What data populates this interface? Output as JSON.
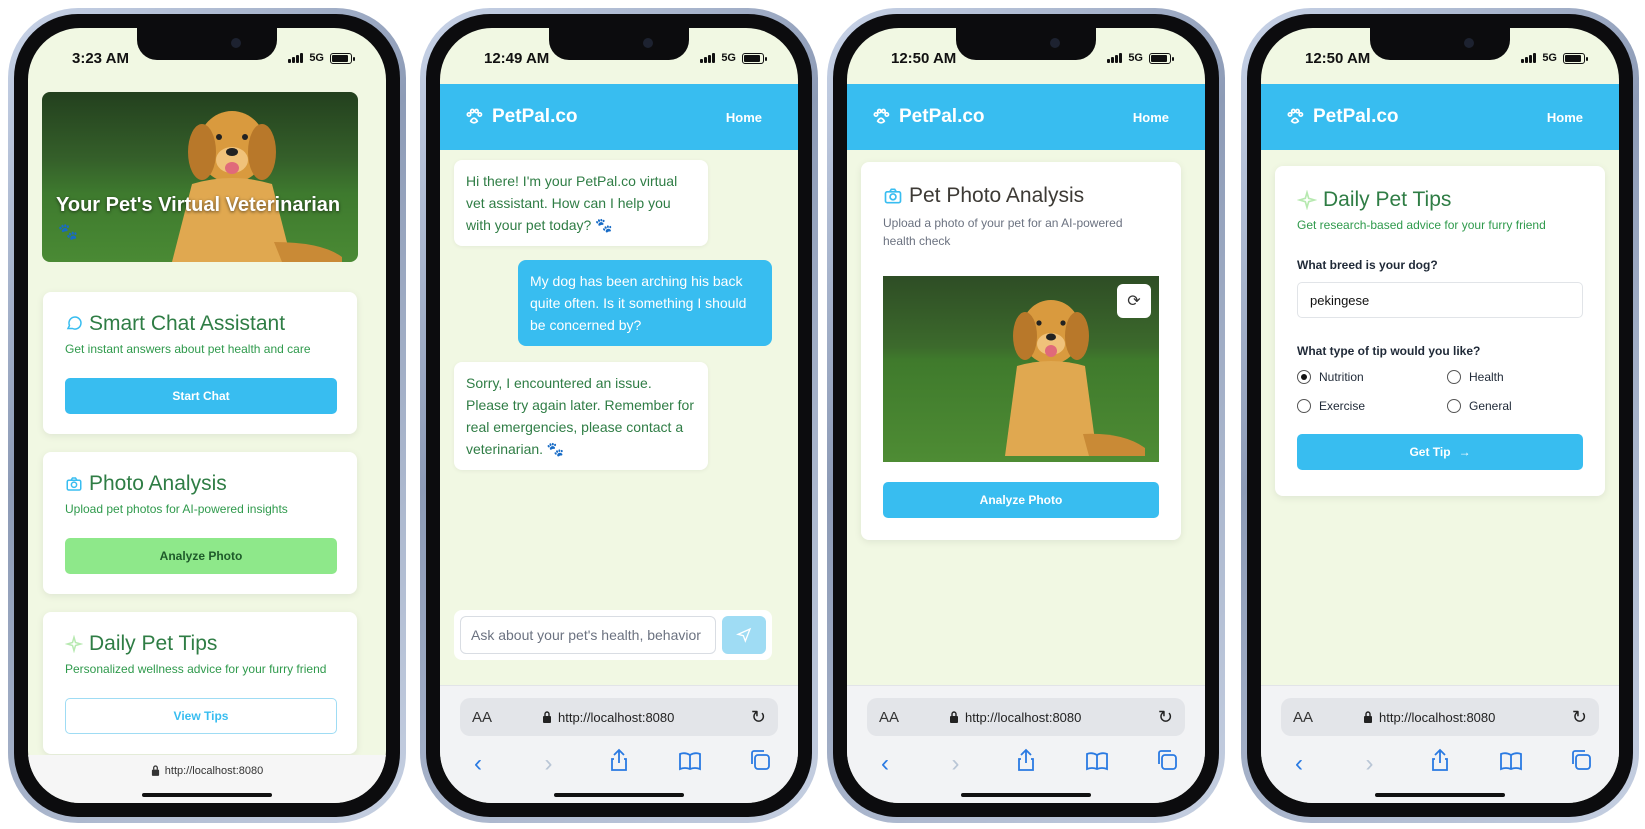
{
  "phones": {
    "p1": {
      "time": "3:23 AM",
      "network": "5G",
      "hero_title": "Your Pet's Virtual Veterinarian",
      "hero_emoji": "🐾",
      "features": [
        {
          "title": "Smart Chat Assistant",
          "subtitle": "Get instant answers about pet health and care",
          "button": "Start Chat",
          "icon": "chat-icon"
        },
        {
          "title": "Photo Analysis",
          "subtitle": "Upload pet photos for AI-powered insights",
          "button": "Analyze Photo",
          "icon": "camera-icon"
        },
        {
          "title": "Daily Pet Tips",
          "subtitle": "Personalized wellness advice for your furry friend",
          "button": "View Tips",
          "icon": "sparkle-icon"
        }
      ],
      "url": "http://localhost:8080"
    },
    "p2": {
      "time": "12:49 AM",
      "network": "5G",
      "brand": "PetPal.co",
      "nav_home": "Home",
      "messages": [
        {
          "from": "bot",
          "text": "Hi there! I'm your PetPal.co virtual vet assistant. How can I help you with your pet today? 🐾"
        },
        {
          "from": "user",
          "text": "My dog has been arching his back quite often. Is it something I should be concerned by?"
        },
        {
          "from": "bot",
          "text": "Sorry, I encountered an issue. Please try again later. Remember for real emergencies, please contact a veterinarian. 🐾"
        }
      ],
      "input_placeholder": "Ask about your pet's health, behavior",
      "aa": "AA",
      "url": "http://localhost:8080"
    },
    "p3": {
      "time": "12:50 AM",
      "network": "5G",
      "brand": "PetPal.co",
      "nav_home": "Home",
      "title": "Pet Photo Analysis",
      "subtitle": "Upload a photo of your pet for an AI-powered health check",
      "button": "Analyze Photo",
      "aa": "AA",
      "url": "http://localhost:8080"
    },
    "p4": {
      "time": "12:50 AM",
      "network": "5G",
      "brand": "PetPal.co",
      "nav_home": "Home",
      "title": "Daily Pet Tips",
      "subtitle": "Get research-based advice for your furry friend",
      "breed_label": "What breed is your dog?",
      "breed_value": "pekingese",
      "tip_label": "What type of tip would you like?",
      "options": [
        {
          "label": "Nutrition",
          "selected": true
        },
        {
          "label": "Health",
          "selected": false
        },
        {
          "label": "Exercise",
          "selected": false
        },
        {
          "label": "General",
          "selected": false
        }
      ],
      "button": "Get Tip",
      "aa": "AA",
      "url": "http://localhost:8080"
    }
  },
  "colors": {
    "accent": "#38bdf0",
    "green_button": "#8ee88a",
    "background": "#f1f8e3",
    "title_green": "#2f7d45"
  }
}
